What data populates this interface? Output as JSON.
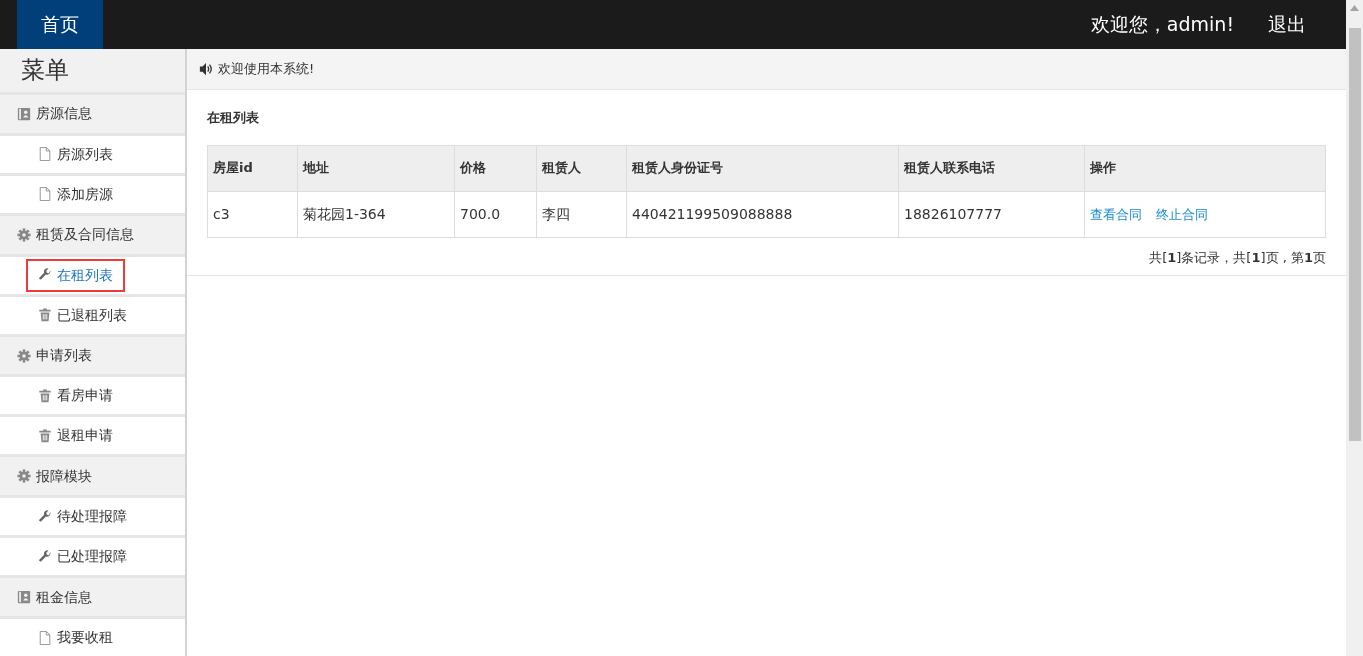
{
  "navbar": {
    "brand": "首页",
    "welcome": "欢迎您，admin!",
    "logout": "退出"
  },
  "sidebar": {
    "title": "菜单",
    "groups": [
      {
        "label": "房源信息",
        "items": [
          {
            "label": "房源列表",
            "selected": false
          },
          {
            "label": "添加房源",
            "selected": false
          }
        ]
      },
      {
        "label": "租赁及合同信息",
        "items": [
          {
            "label": "在租列表",
            "selected": true
          },
          {
            "label": "已退租列表",
            "selected": false
          }
        ]
      },
      {
        "label": "申请列表",
        "items": [
          {
            "label": "看房申请",
            "selected": false
          },
          {
            "label": "退租申请",
            "selected": false
          }
        ]
      },
      {
        "label": "报障模块",
        "items": [
          {
            "label": "待处理报障",
            "selected": false
          },
          {
            "label": "已处理报障",
            "selected": false
          }
        ]
      },
      {
        "label": "租金信息",
        "items": [
          {
            "label": "我要收租",
            "selected": false
          }
        ]
      }
    ]
  },
  "notice": "欢迎使用本系统!",
  "panel_title": "在租列表",
  "table": {
    "columns": [
      "房屋id",
      "地址",
      "价格",
      "租赁人",
      "租赁人身份证号",
      "租赁人联系电话",
      "操作"
    ],
    "rows": [
      {
        "cells": [
          "c3",
          "菊花园1-364",
          "700.0",
          "李四",
          "440421199509088888",
          "18826107777"
        ],
        "actions": [
          "查看合同",
          "终止合同"
        ]
      }
    ]
  },
  "pagination": "共[**1**]条记录，共[**1**]页 , 第**1**页"
}
